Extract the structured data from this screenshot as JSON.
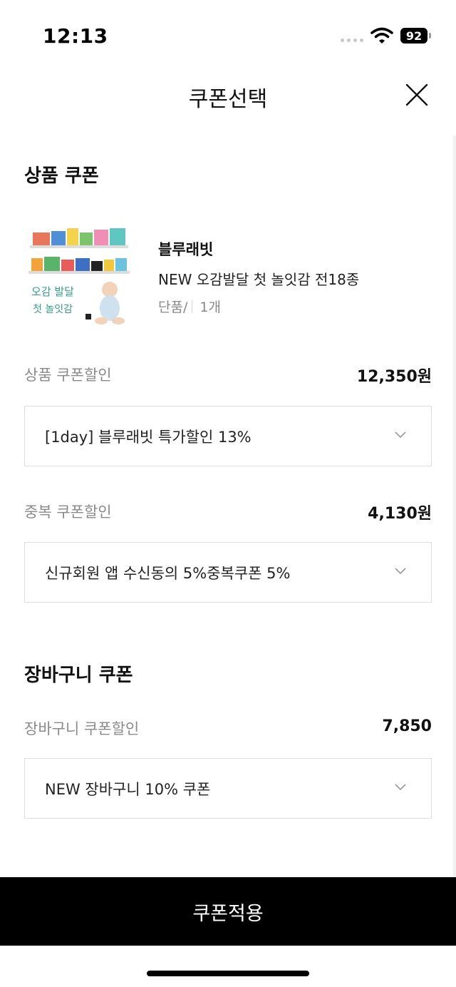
{
  "status_bar": {
    "time": "12:13",
    "battery": "92"
  },
  "header": {
    "title": "쿠폰선택"
  },
  "product_coupon": {
    "section_title": "상품 쿠폰",
    "product": {
      "brand": "블루래빗",
      "name": "NEW 오감발달 첫 놀잇감 전18종",
      "option": "단품/",
      "quantity": "1개",
      "thumbnail_text": "오감 발달 첫 놀잇감"
    },
    "discount": {
      "label": "상품 쿠폰할인",
      "amount": "12,350원",
      "selected": "[1day] 블루래빗 특가할인 13%"
    },
    "duplicate": {
      "label": "중복 쿠폰할인",
      "amount": "4,130원",
      "selected": "신규회원 앱 수신동의 5%중복쿠폰 5%"
    }
  },
  "cart_coupon": {
    "section_title": "장바구니 쿠폰",
    "discount": {
      "label": "장바구니 쿠폰할인",
      "amount": "7,850",
      "selected": "NEW 장바구니 10% 쿠폰"
    }
  },
  "footer": {
    "apply_label": "쿠폰적용"
  },
  "colors": {
    "accent": "#000000",
    "muted_text": "#8a8a8a",
    "border": "#dedede"
  }
}
